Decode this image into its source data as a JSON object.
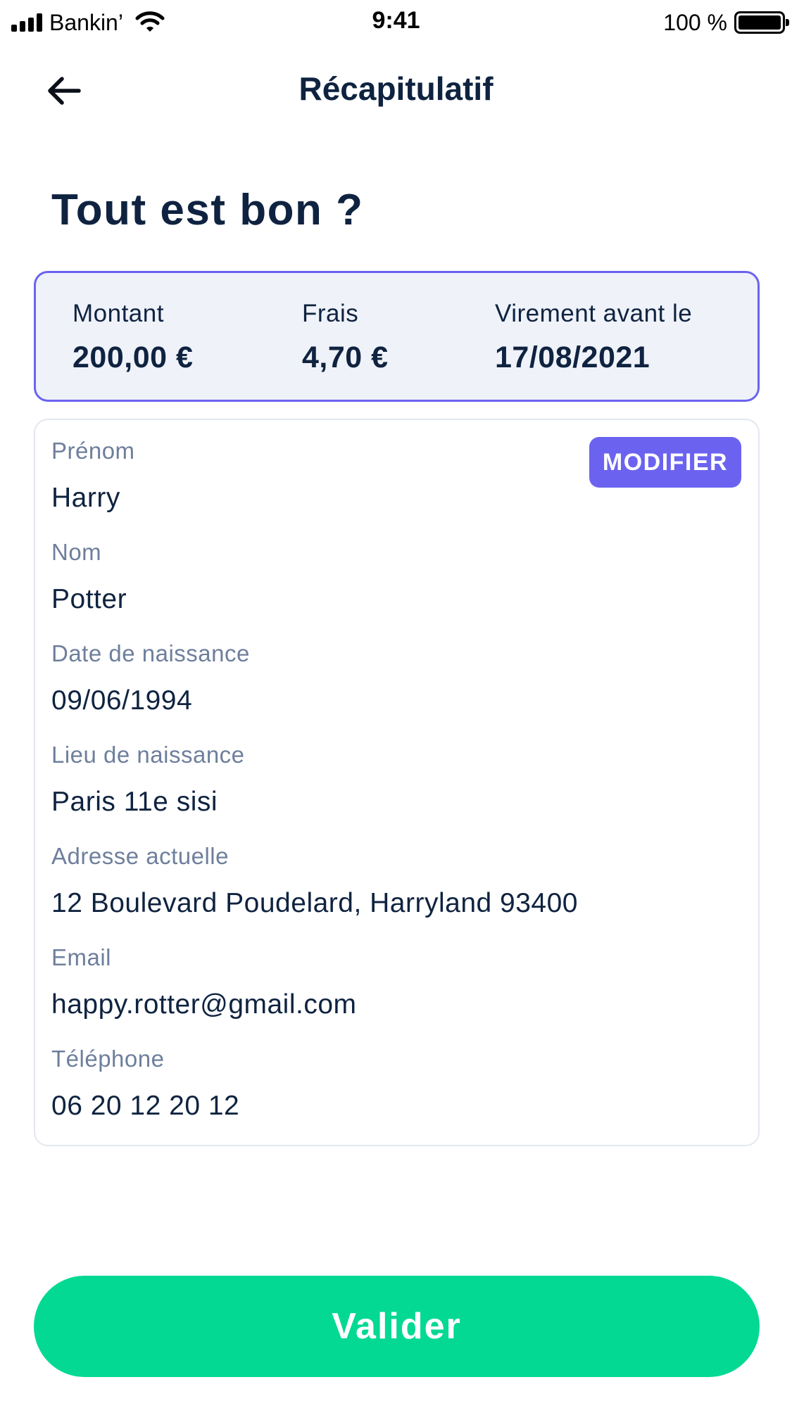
{
  "status_bar": {
    "carrier": "Bankin’",
    "time": "9:41",
    "battery_percent": "100 %"
  },
  "header": {
    "title": "Récapitulatif",
    "back_icon": "arrow-left-icon"
  },
  "page": {
    "heading": "Tout est bon ?"
  },
  "summary": {
    "amount_label": "Montant",
    "amount_value": "200,00 €",
    "fees_label": "Frais",
    "fees_value": "4,70 €",
    "deadline_label": "Virement avant le",
    "deadline_value": "17/08/2021"
  },
  "details": {
    "modify_label": "MODIFIER",
    "fields": [
      {
        "label": "Prénom",
        "value": "Harry"
      },
      {
        "label": "Nom",
        "value": "Potter"
      },
      {
        "label": "Date de naissance",
        "value": "09/06/1994"
      },
      {
        "label": "Lieu de naissance",
        "value": "Paris 11e sisi"
      },
      {
        "label": "Adresse actuelle",
        "value": "12 Boulevard Poudelard, Harryland 93400"
      },
      {
        "label": "Email",
        "value": "happy.rotter@gmail.com"
      },
      {
        "label": "Téléphone",
        "value": "06 20 12 20 12"
      }
    ]
  },
  "actions": {
    "validate_label": "Valider"
  },
  "colors": {
    "accent": "#6b63f0",
    "success": "#03d993",
    "text_primary": "#0f2340",
    "text_secondary": "#6e7f9c",
    "summary_bg": "#eff2f9"
  }
}
